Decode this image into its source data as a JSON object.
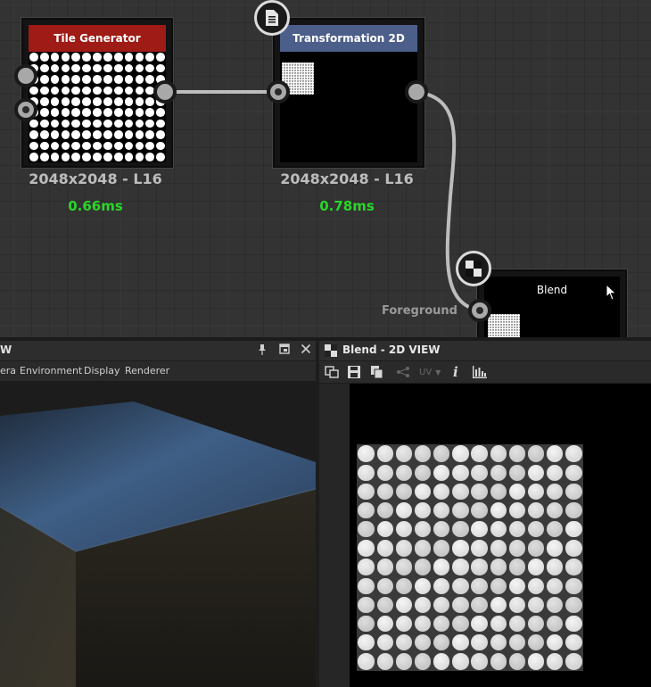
{
  "graph": {
    "nodes": [
      {
        "title": "Tile Generator",
        "title_color": "#9f1b16",
        "resolution": "2048x2048 - L16",
        "time": "0.66ms"
      },
      {
        "title": "Transformation 2D",
        "title_color": "#4c5e8a",
        "resolution": "2048x2048 - L16",
        "time": "0.78ms"
      },
      {
        "title": "Blend",
        "title_color": "#000000"
      }
    ],
    "foreground_label": "Foreground",
    "time_color": "#29d629",
    "wire_color": "#bdbdbd"
  },
  "left_panel": {
    "title_fragment": "W",
    "menu": [
      "era",
      "Environment",
      "Display",
      "Renderer"
    ],
    "icons": [
      "pin-icon",
      "float-window-icon",
      "close-icon"
    ]
  },
  "right_panel": {
    "title": "Blend - 2D VIEW",
    "toolbar": {
      "uv_label": "UV",
      "info_label": "i"
    },
    "icons": [
      "view-icon",
      "save-icon",
      "copy-icon",
      "nodes-icon",
      "uv-icon",
      "info-icon",
      "histogram-icon"
    ]
  },
  "tile_pattern": {
    "rows": 12,
    "cols": 12
  }
}
